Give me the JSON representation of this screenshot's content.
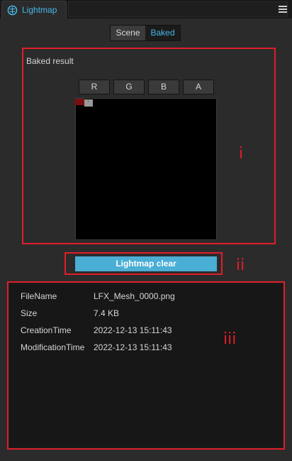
{
  "tab": {
    "label": "Lightmap",
    "icon": "lightmap-icon"
  },
  "toolbar": {
    "menu_icon": "hamburger-menu-icon"
  },
  "mode_toggle": {
    "options": [
      "Scene",
      "Baked"
    ],
    "selected": "Baked"
  },
  "baked": {
    "title": "Baked result",
    "channels": [
      "R",
      "G",
      "B",
      "A"
    ]
  },
  "clear_button": {
    "label": "Lightmap clear"
  },
  "file_info": {
    "rows": [
      {
        "key": "FileName",
        "value": "LFX_Mesh_0000.png"
      },
      {
        "key": "Size",
        "value": "7.4 KB"
      },
      {
        "key": "CreationTime",
        "value": "2022-12-13 15:11:43"
      },
      {
        "key": "ModificationTime",
        "value": "2022-12-13 15:11:43"
      }
    ]
  },
  "annotations": {
    "i": "i",
    "ii": "ii",
    "iii": "iii"
  },
  "colors": {
    "accent": "#48b6e6",
    "button": "#4aaed5",
    "highlight": "#e01e2b"
  }
}
